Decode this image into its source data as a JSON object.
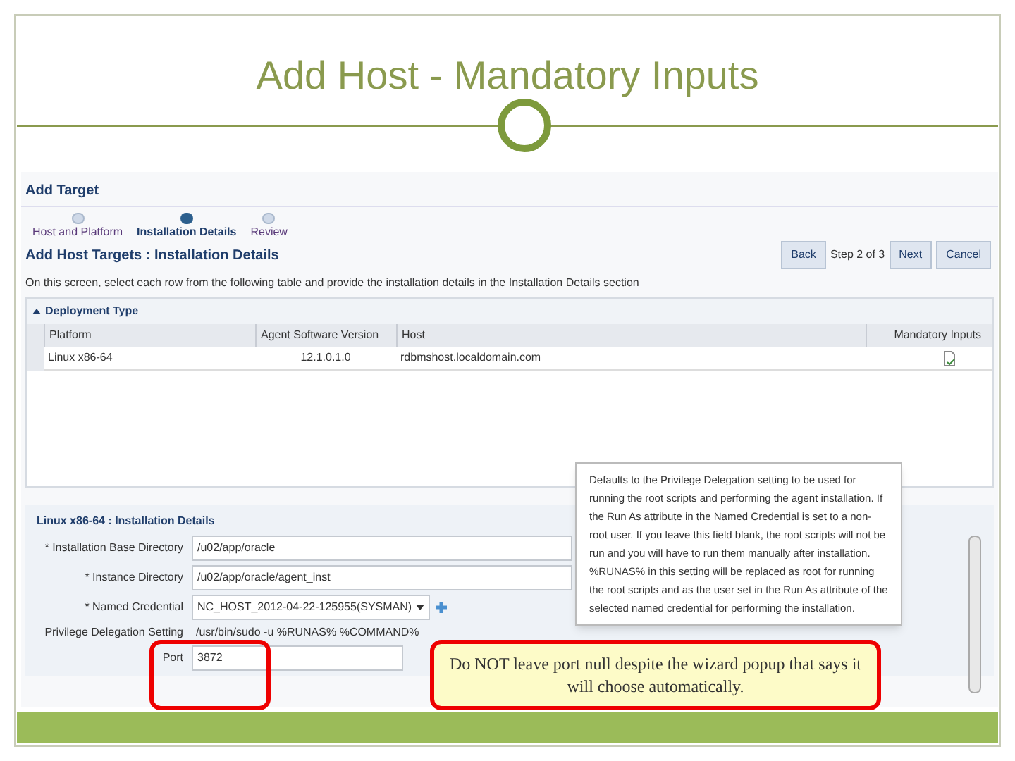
{
  "slide": {
    "title": "Add Host - Mandatory Inputs"
  },
  "wizard": {
    "title": "Add Target",
    "steps": [
      {
        "label": "Host and Platform",
        "selected": false
      },
      {
        "label": "Installation Details",
        "selected": true
      },
      {
        "label": "Review",
        "selected": false
      }
    ],
    "page_title": "Add Host Targets : Installation Details",
    "buttons": [
      {
        "kind": "button",
        "label": "Back"
      },
      {
        "kind": "text",
        "label": "Step 2 of 3"
      },
      {
        "kind": "button",
        "label": "Next"
      },
      {
        "kind": "button",
        "label": "Cancel"
      }
    ],
    "instruction": "On this screen, select each row from the following table and provide the installation details in the Installation Details section"
  },
  "deployment": {
    "title": "Deployment Type",
    "columns": [
      "Platform",
      "Agent Software Version",
      "Host",
      "Mandatory Inputs"
    ],
    "rows": [
      {
        "platform": "Linux x86-64",
        "version": "12.1.0.1.0",
        "host": "rdbmshost.localdomain.com",
        "selected": false
      }
    ]
  },
  "details": {
    "title": "Linux x86-64 : Installation Details",
    "fields": [
      {
        "label": "* Installation Base Directory",
        "value": "/u02/app/oracle",
        "kind": "input"
      },
      {
        "label": "* Instance Directory",
        "value": "/u02/app/oracle/agent_inst",
        "kind": "input"
      },
      {
        "label": "* Named Credential",
        "value": "NC_HOST_2012-04-22-125955(SYSMAN)",
        "kind": "select"
      },
      {
        "label": "Privilege Delegation Setting",
        "value": "/usr/bin/sudo -u %RUNAS% %COMMAND%",
        "kind": "text"
      },
      {
        "label": "Port",
        "value": "3872",
        "kind": "input"
      }
    ]
  },
  "tooltip": "Defaults to the Privilege Delegation setting to be used for running the root scripts and performing the agent installation. If the Run As attribute in the Named Credential is set to a non-root user. If you leave this field blank, the root scripts will not be run and you will have to run them manually after installation. %RUNAS% in this setting will be replaced as root for running the root scripts and as the user set in the Run As attribute of the selected named credential for performing the installation.",
  "callout": "Do NOT leave port null despite the wizard popup that says it will choose automatically."
}
